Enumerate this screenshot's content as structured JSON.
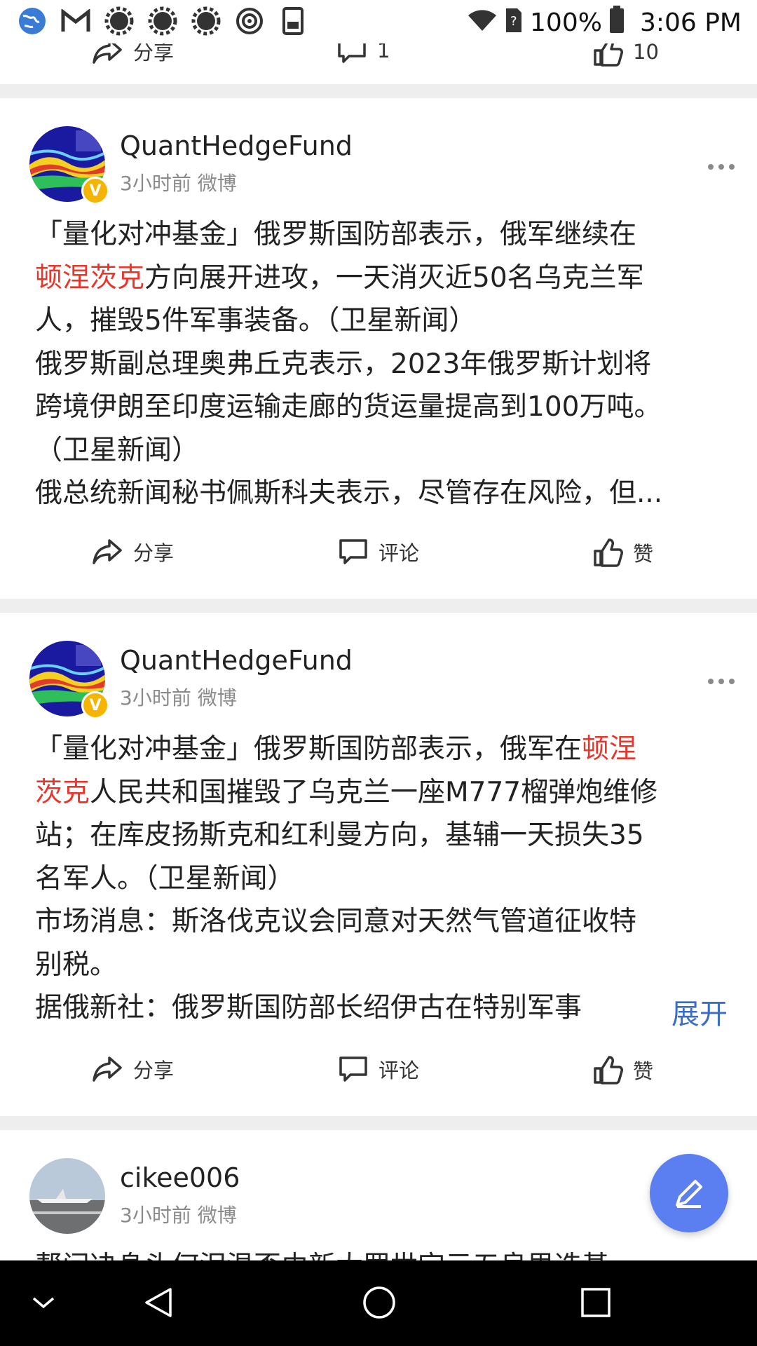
{
  "status_bar": {
    "icons": [
      "globe-icon",
      "gmail-icon",
      "gear-icon",
      "gear-icon",
      "gear-icon",
      "target-icon",
      "reader-icon"
    ],
    "battery": "100%",
    "time": "3:06 PM"
  },
  "actions": {
    "share": "分享",
    "comment": "评论",
    "like": "赞"
  },
  "cutoff_actions": {
    "share": "分享",
    "comment": "1",
    "like": "10"
  },
  "posts": [
    {
      "username": "QuantHedgeFund",
      "meta": "3小时前 微博",
      "lines": [
        [
          "「量化对冲基金」俄罗斯国防部表示，俄军继续在"
        ],
        [
          "顿涅茨克",
          "方向展开进攻，一天消灭近50名乌克兰军"
        ],
        [
          "人，摧毁5件军事装备。（卫星新闻）"
        ],
        [
          "俄罗斯副总理奥弗丘克表示，2023年俄罗斯计划将"
        ],
        [
          "跨境伊朗至印度运输走廊的货运量提高到100万吨。"
        ],
        [
          "（卫星新闻）"
        ],
        [
          "俄总统新闻秘书佩斯科夫表示，尽管存在风险，但..."
        ]
      ]
    },
    {
      "username": "QuantHedgeFund",
      "meta": "3小时前 微博",
      "lines": [
        [
          "「量化对冲基金」俄罗斯国防部表示，俄军在",
          "顿涅"
        ],
        [
          "茨克",
          "人民共和国摧毁了乌克兰一座M777榴弹炮维修"
        ],
        [
          "站；在库皮扬斯克和红利曼方向，基辅一天损失35"
        ],
        [
          "名军人。（卫星新闻）"
        ],
        [
          "市场消息：斯洛伐克议会同意对天然气管道征收特"
        ],
        [
          "别税。"
        ],
        [
          "据俄新社：俄罗斯国防部长绍伊古在特别军事"
        ]
      ],
      "expand": "展开"
    },
    {
      "username": "cikee006",
      "meta": "3小时前 微博",
      "partial_line": "帮问决身头何泪温否由新大罗世定元五良思选基"
    }
  ],
  "nav": [
    "collapse-icon",
    "back-icon",
    "home-icon",
    "recents-icon"
  ]
}
